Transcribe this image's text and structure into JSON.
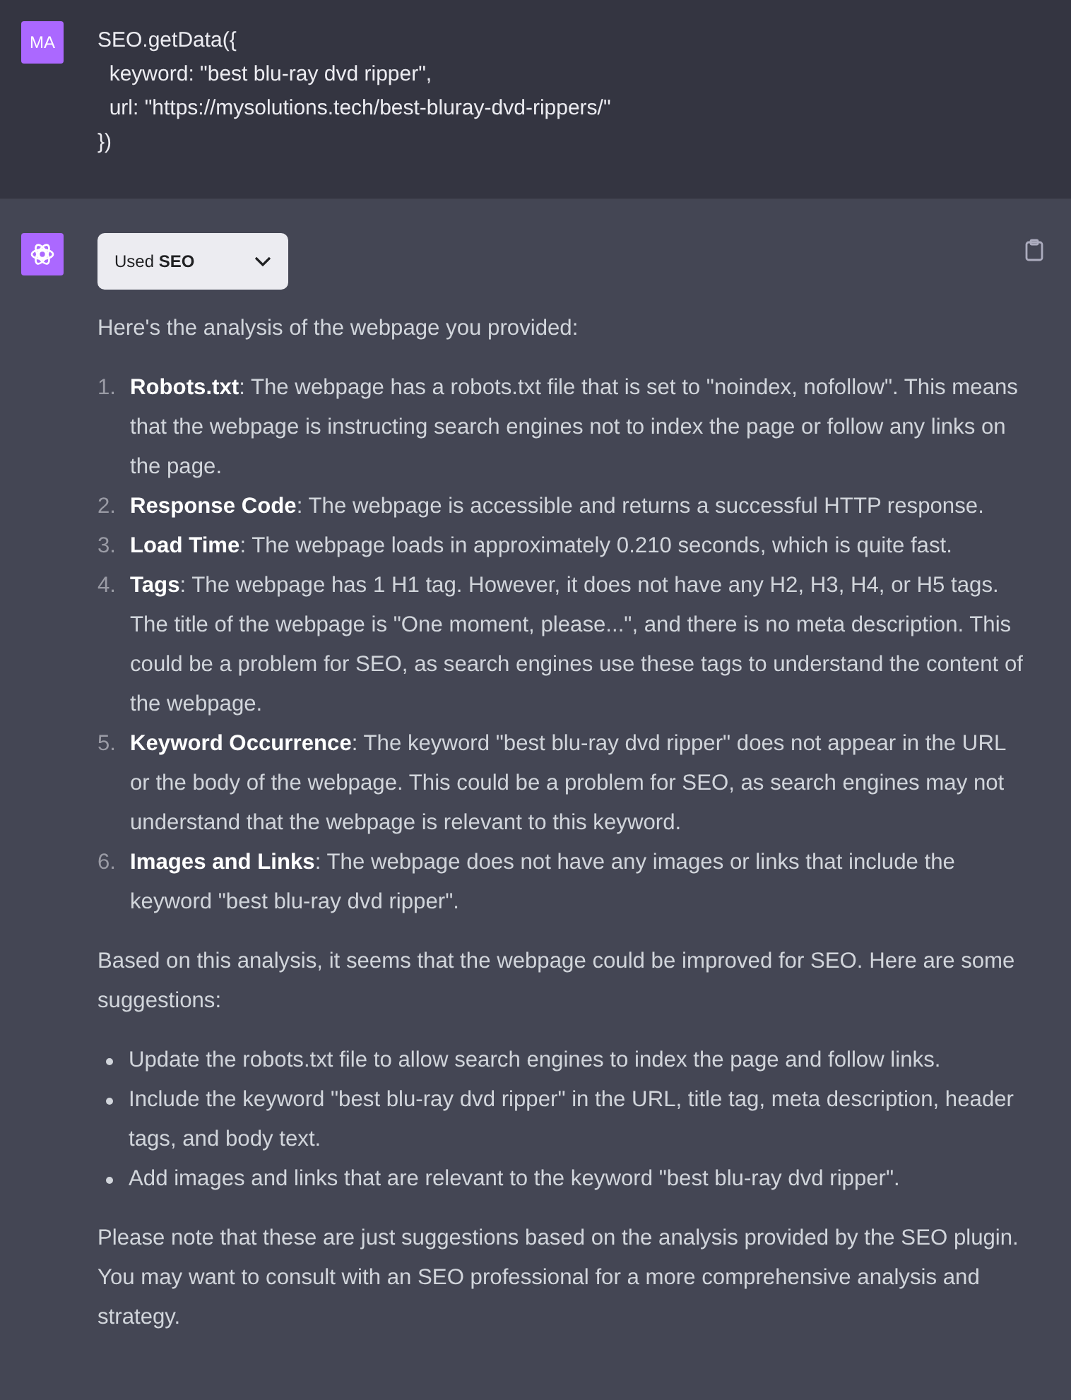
{
  "user_message": {
    "avatar": "MA",
    "lines": [
      "SEO.getData({",
      "  keyword: \"best blu-ray dvd ripper\",",
      "  url: \"https://mysolutions.tech/best-bluray-dvd-rippers/\"",
      "})"
    ]
  },
  "assistant_message": {
    "plugin_button": {
      "label": "Used **SEO**",
      "expanded": false
    },
    "intro": "Here's the analysis of the webpage you provided:",
    "findings": [
      {
        "number": "1.",
        "title": "Robots.txt",
        "text": ": The webpage has a robots.txt file that is set to \"noindex, nofollow\". This means that the webpage is instructing search engines not to index the page or follow any links on the page."
      },
      {
        "number": "2.",
        "title": "Response Code",
        "text": ": The webpage is accessible and returns a successful HTTP response."
      },
      {
        "number": "3.",
        "title": "Load Time",
        "text": ": The webpage loads in approximately 0.210 seconds, which is quite fast."
      },
      {
        "number": "4.",
        "title": "Tags",
        "text": ": The webpage has 1 H1 tag. However, it does not have any H2, H3, H4, or H5 tags. The title of the webpage is \"One moment, please...\", and there is no meta description. This could be a problem for SEO, as search engines use these tags to understand the content of the webpage."
      },
      {
        "number": "5.",
        "title": "Keyword Occurrence",
        "text": ": The keyword \"best blu-ray dvd ripper\" does not appear in the URL or the body of the webpage. This could be a problem for SEO, as search engines may not understand that the webpage is relevant to this keyword."
      },
      {
        "number": "6.",
        "title": "Images and Links",
        "text": ": The webpage does not have any images or links that include the keyword \"best blu-ray dvd ripper\"."
      }
    ],
    "summary": "Based on this analysis, it seems that the webpage could be improved for SEO. Here are some suggestions:",
    "suggestions": [
      "Update the robots.txt file to allow search engines to index the page and follow links.",
      "Include the keyword \"best blu-ray dvd ripper\" in the URL, title tag, meta description, header tags, and body text.",
      "Add images and links that are relevant to the keyword \"best blu-ray dvd ripper\"."
    ],
    "closing": "Please note that these are just suggestions based on the analysis provided by the SEO plugin. You may want to consult with an SEO professional for a more comprehensive analysis and strategy."
  }
}
